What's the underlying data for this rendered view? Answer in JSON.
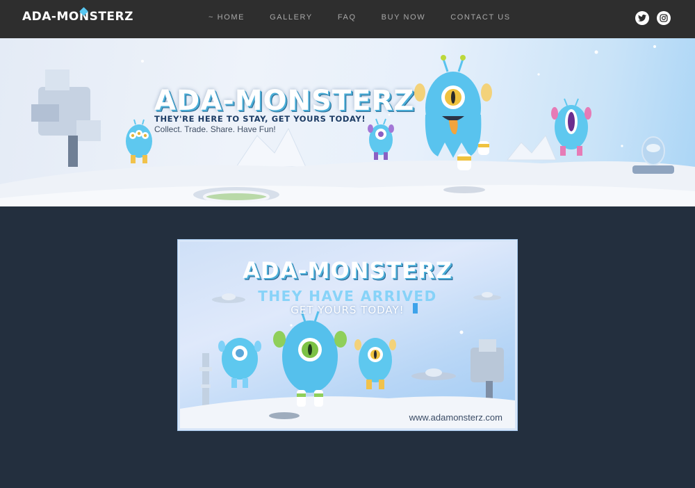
{
  "nav": {
    "logo": "ADA-MONSTERZ",
    "items": [
      {
        "label": "~ HOME"
      },
      {
        "label": "GALLERY"
      },
      {
        "label": "FAQ"
      },
      {
        "label": "BUY NOW"
      },
      {
        "label": "CONTACT US"
      }
    ],
    "social": [
      {
        "icon": "twitter-icon"
      },
      {
        "icon": "instagram-icon"
      }
    ]
  },
  "hero": {
    "title": "ADA-MONSTERZ",
    "tagline": "THEY'RE HERE TO STAY, GET YOURS TODAY!",
    "subtitle": "Collect. Trade. Share. Have Fun!"
  },
  "banner": {
    "title": "ADA-MONSTERZ",
    "line1": "THEY HAVE ARRIVED",
    "line2": "GET YOURS TODAY!",
    "url": "www.adamonsterz.com"
  },
  "colors": {
    "nav_bg": "#2e2e2e",
    "page_bg": "#232f3e",
    "accent": "#58c6f0",
    "nav_text": "#a9a9a9"
  }
}
